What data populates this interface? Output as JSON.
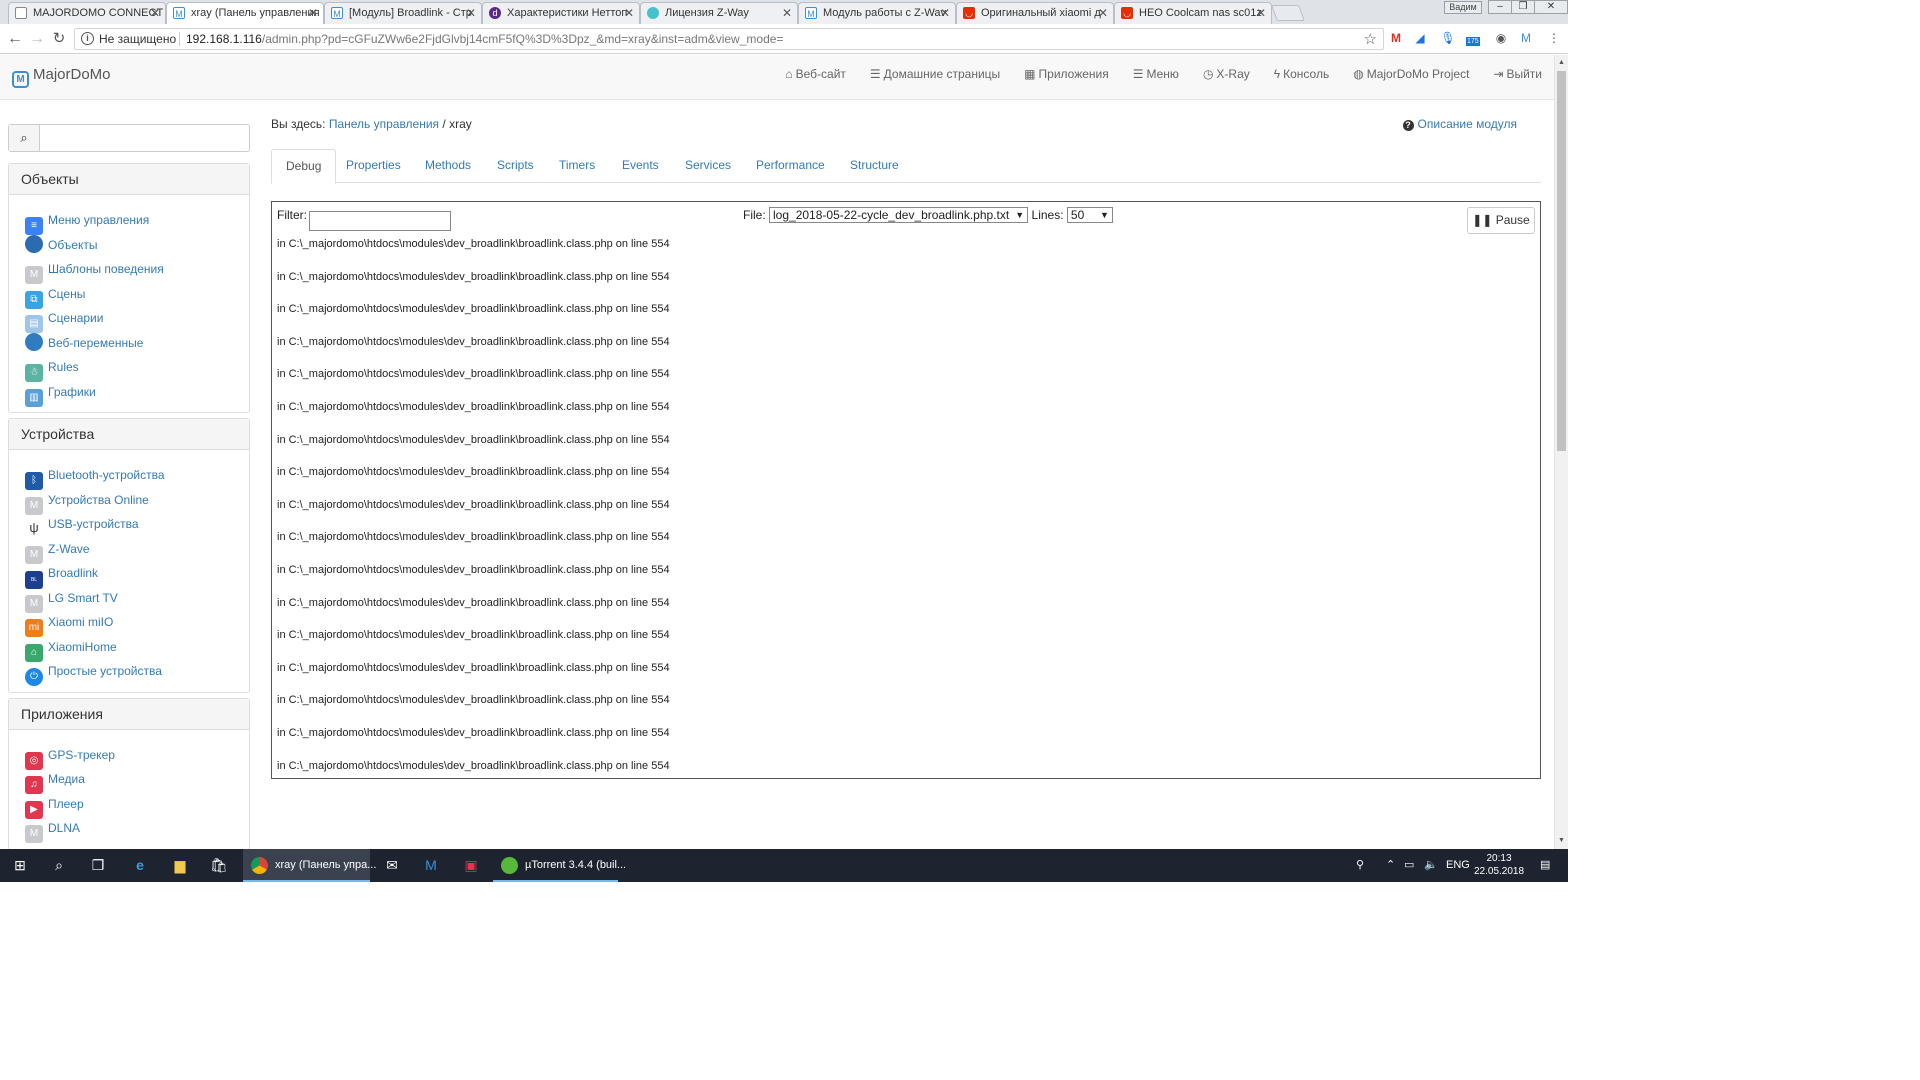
{
  "browser": {
    "tabs": [
      {
        "title": "MAJORDOMO CONNECT",
        "icon": "page-icon",
        "color": "#ffffff"
      },
      {
        "title": "xray (Панель управления",
        "icon": "majordomo-icon",
        "color": "#3a8fd9"
      },
      {
        "title": "[Модуль] Broadlink - Стр",
        "icon": "majordomo-icon",
        "color": "#3a8fd9"
      },
      {
        "title": "Характеристики Неттоп",
        "icon": "dns-icon",
        "color": "#5b2a86"
      },
      {
        "title": "Лицензия Z-Way",
        "icon": "zway-icon",
        "color": "#45c1c9"
      },
      {
        "title": "Модуль работы с Z-Wav",
        "icon": "majordomo-icon",
        "color": "#3a8fd9"
      },
      {
        "title": "Оригинальный xiaomi д",
        "icon": "aliexpress-icon",
        "color": "#e62e04"
      },
      {
        "title": "HEO Coolcam nas sc01z",
        "icon": "aliexpress-icon",
        "color": "#e62e04"
      }
    ],
    "window_user": "Вадим",
    "security_label": "Не защищено",
    "url_host": "192.168.1.116",
    "url_path": "/admin.php?pd=cGFuZWw6e2FjdGlvbj14cmF5fQ%3D%3Dpz_&md=xray&inst=adm&view_mode=",
    "extension_badge": "175"
  },
  "navbar": {
    "brand": "MajorDoMo",
    "items": [
      {
        "label": "Веб-сайт",
        "icon": "home-icon"
      },
      {
        "label": "Домашние страницы",
        "icon": "list-icon"
      },
      {
        "label": "Приложения",
        "icon": "grid-icon"
      },
      {
        "label": "Меню",
        "icon": "list-icon"
      },
      {
        "label": "X-Ray",
        "icon": "clock-icon"
      },
      {
        "label": "Консоль",
        "icon": "flash-icon"
      },
      {
        "label": "MajorDoMo Project",
        "icon": "globe-icon"
      },
      {
        "label": "Выйти",
        "icon": "logout-icon"
      }
    ]
  },
  "sidebar": {
    "search_placeholder": "",
    "sections": [
      {
        "title": "Объекты",
        "items": [
          {
            "label": "Меню управления",
            "color": "#3b82f6"
          },
          {
            "label": "Объекты",
            "color": "#2b6cb0"
          },
          {
            "label": "Шаблоны поведения",
            "color": "#c7c9cc"
          },
          {
            "label": "Сцены",
            "color": "#3aa3e3"
          },
          {
            "label": "Сценарии",
            "color": "#9fc6e8"
          },
          {
            "label": "Веб-переменные",
            "color": "#2f7dc0"
          },
          {
            "label": "Rules",
            "color": "#5db3a1"
          },
          {
            "label": "Графики",
            "color": "#5aa0d8"
          }
        ]
      },
      {
        "title": "Устройства",
        "items": [
          {
            "label": "Bluetooth-устройства",
            "color": "#1e5aa8"
          },
          {
            "label": "Устройства Online",
            "color": "#c7c9cc"
          },
          {
            "label": "USB-устройства",
            "color": "#333333"
          },
          {
            "label": "Z-Wave",
            "color": "#c7c9cc"
          },
          {
            "label": "Broadlink",
            "color": "#1d3f8f"
          },
          {
            "label": "LG Smart TV",
            "color": "#c7c9cc"
          },
          {
            "label": "Xiaomi miIO",
            "color": "#f07c1a"
          },
          {
            "label": "XiaomiHome",
            "color": "#3aa76d"
          },
          {
            "label": "Простые устройства",
            "color": "#1e88e5"
          }
        ]
      },
      {
        "title": "Приложения",
        "items": [
          {
            "label": "GPS-трекер",
            "color": "#e0364f"
          },
          {
            "label": "Медиа",
            "color": "#e0364f"
          },
          {
            "label": "Плеер",
            "color": "#e0364f"
          },
          {
            "label": "DLNA",
            "color": "#c7c9cc"
          }
        ]
      }
    ]
  },
  "main": {
    "breadcrumb_prefix": "Вы здесь:",
    "breadcrumb_link": "Панель управления",
    "breadcrumb_sep": "/",
    "breadcrumb_current": "xray",
    "module_help": "Описание модуля",
    "tabs": [
      "Debug",
      "Properties",
      "Methods",
      "Scripts",
      "Timers",
      "Events",
      "Services",
      "Performance",
      "Structure"
    ],
    "active_tab": "Debug",
    "filter_label": "Filter:",
    "filter_value": "",
    "file_label": "File:",
    "file_value": "log_2018-05-22-cycle_dev_broadlink.php.txt",
    "lines_label": "Lines:",
    "lines_value": "50",
    "pause_label": "Pause",
    "log_lines": [
      "in C:\\_majordomo\\htdocs\\modules\\dev_broadlink\\broadlink.class.php on line 554",
      "in C:\\_majordomo\\htdocs\\modules\\dev_broadlink\\broadlink.class.php on line 554",
      "in C:\\_majordomo\\htdocs\\modules\\dev_broadlink\\broadlink.class.php on line 554",
      "in C:\\_majordomo\\htdocs\\modules\\dev_broadlink\\broadlink.class.php on line 554",
      "in C:\\_majordomo\\htdocs\\modules\\dev_broadlink\\broadlink.class.php on line 554",
      "in C:\\_majordomo\\htdocs\\modules\\dev_broadlink\\broadlink.class.php on line 554",
      "in C:\\_majordomo\\htdocs\\modules\\dev_broadlink\\broadlink.class.php on line 554",
      "in C:\\_majordomo\\htdocs\\modules\\dev_broadlink\\broadlink.class.php on line 554",
      "in C:\\_majordomo\\htdocs\\modules\\dev_broadlink\\broadlink.class.php on line 554",
      "in C:\\_majordomo\\htdocs\\modules\\dev_broadlink\\broadlink.class.php on line 554",
      "in C:\\_majordomo\\htdocs\\modules\\dev_broadlink\\broadlink.class.php on line 554",
      "in C:\\_majordomo\\htdocs\\modules\\dev_broadlink\\broadlink.class.php on line 554",
      "in C:\\_majordomo\\htdocs\\modules\\dev_broadlink\\broadlink.class.php on line 554",
      "in C:\\_majordomo\\htdocs\\modules\\dev_broadlink\\broadlink.class.php on line 554",
      "in C:\\_majordomo\\htdocs\\modules\\dev_broadlink\\broadlink.class.php on line 554",
      "in C:\\_majordomo\\htdocs\\modules\\dev_broadlink\\broadlink.class.php on line 554",
      "in C:\\_majordomo\\htdocs\\modules\\dev_broadlink\\broadlink.class.php on line 554"
    ]
  },
  "taskbar": {
    "apps": [
      {
        "label": "xray (Панель упра...",
        "icon": "chrome-icon",
        "active": true
      },
      {
        "label": "µTorrent 3.4.4  (buil...",
        "icon": "utorrent-icon",
        "active": false
      }
    ],
    "language": "ENG",
    "time": "20:13",
    "date": "22.05.2018"
  }
}
